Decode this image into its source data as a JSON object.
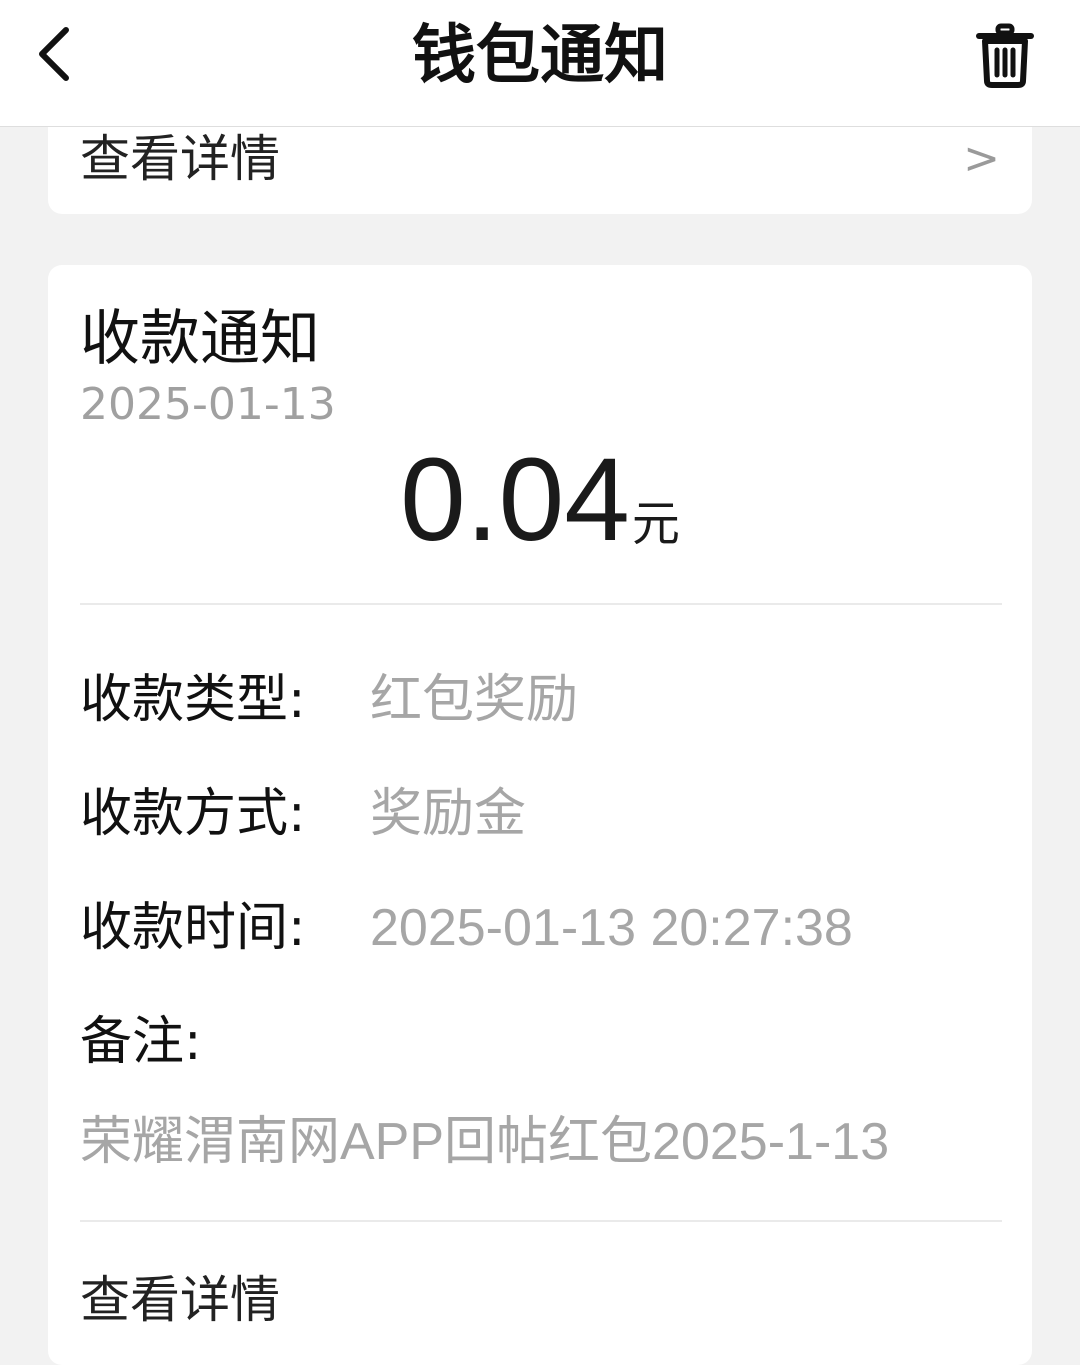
{
  "header": {
    "title": "钱包通知",
    "back_icon": "chevron-left-icon",
    "trash_icon": "trash-icon"
  },
  "top_card": {
    "detail_label": "查看详情",
    "chevron": ">"
  },
  "notice": {
    "title": "收款通知",
    "date": "2025-01-13",
    "amount": "0.04",
    "unit": "元",
    "fields": [
      {
        "label": "收款类型:",
        "value": "红包奖励"
      },
      {
        "label": "收款方式:",
        "value": "奖励金"
      },
      {
        "label": "收款时间:",
        "value": "2025-01-13 20:27:38"
      }
    ],
    "remark_label": "备注:",
    "remark_value": "荣耀渭南网APP回帖红包2025-1-13",
    "detail_label": "查看详情"
  },
  "colors": {
    "background": "#f2f2f2",
    "card": "#ffffff",
    "primary_text": "#111111",
    "secondary_text": "#a6a6a6"
  }
}
